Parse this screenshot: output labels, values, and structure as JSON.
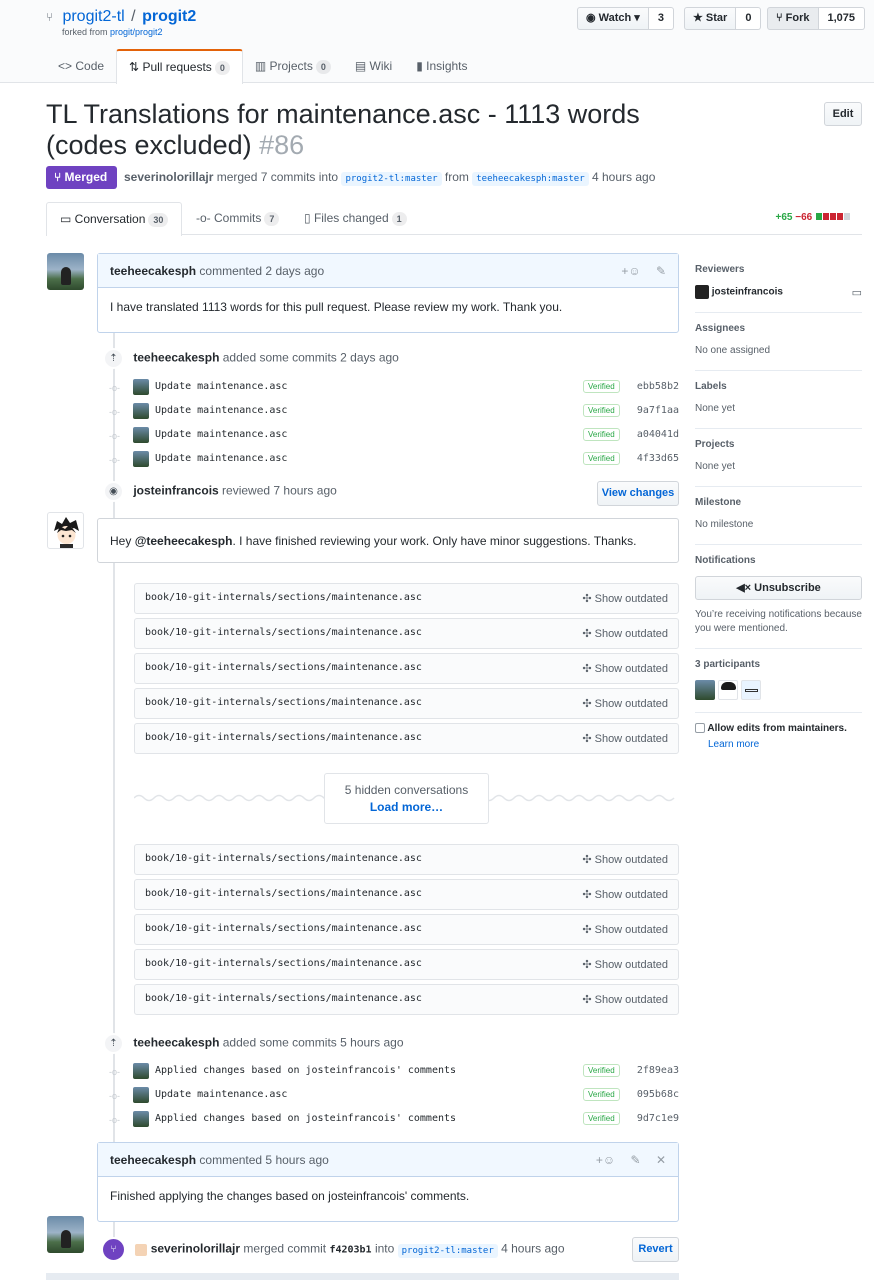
{
  "repo": {
    "owner": "progit2-tl",
    "separator": "/",
    "name": "progit2",
    "forked_prefix": "forked from",
    "forked_from": "progit/progit2",
    "watch_label": "Watch",
    "watch_count": "3",
    "star_label": "Star",
    "star_count": "0",
    "fork_label": "Fork",
    "fork_count": "1,075"
  },
  "nav": {
    "code": "Code",
    "pulls": "Pull requests",
    "pulls_count": "0",
    "projects": "Projects",
    "projects_count": "0",
    "wiki": "Wiki",
    "insights": "Insights"
  },
  "pr": {
    "title": "TL Translations for maintenance.asc - 1113 words (codes excluded)",
    "number": "#86",
    "edit": "Edit",
    "state": "Merged",
    "author": "severinolorillajr",
    "merged_text": "merged 7 commits into",
    "base": "progit2-tl:master",
    "from": "from",
    "head": "teeheecakesph:master",
    "time": "4 hours ago"
  },
  "tabs": {
    "conversation": "Conversation",
    "conversation_count": "30",
    "commits": "Commits",
    "commits_count": "7",
    "files": "Files changed",
    "files_count": "1",
    "additions": "+65",
    "deletions": "−66"
  },
  "comment1": {
    "author": "teeheecakesph",
    "action": "commented 2 days ago",
    "body": "I have translated 1113 words for this pull request. Please review my work. Thank you."
  },
  "event1": {
    "author": "teeheecakesph",
    "action": "added some commits 2 days ago"
  },
  "commits1": [
    {
      "msg": "Update maintenance.asc",
      "verified": "Verified",
      "sha": "ebb58b2"
    },
    {
      "msg": "Update maintenance.asc",
      "verified": "Verified",
      "sha": "9a7f1aa"
    },
    {
      "msg": "Update maintenance.asc",
      "verified": "Verified",
      "sha": "a04041d"
    },
    {
      "msg": "Update maintenance.asc",
      "verified": "Verified",
      "sha": "4f33d65"
    }
  ],
  "review": {
    "author": "josteinfrancois",
    "action": "reviewed 7 hours ago",
    "view_changes": "View changes",
    "body_prefix": "Hey",
    "mention": "@teeheecakesph",
    "body_suffix": ". I have finished reviewing your work. Only have minor suggestions. Thanks."
  },
  "files": {
    "path": "book/10-git-internals/sections/maintenance.asc",
    "show_outdated": "Show outdated"
  },
  "hidden": {
    "text": "5 hidden conversations",
    "load": "Load more…"
  },
  "event2": {
    "author": "teeheecakesph",
    "action": "added some commits 5 hours ago"
  },
  "commits2": [
    {
      "msg": "Applied changes based on josteinfrancois' comments",
      "verified": "Verified",
      "sha": "2f89ea3"
    },
    {
      "msg": "Update maintenance.asc",
      "verified": "Verified",
      "sha": "095b68c"
    },
    {
      "msg": "Applied changes based on josteinfrancois' comments",
      "verified": "Verified",
      "sha": "9d7c1e9"
    }
  ],
  "comment2": {
    "author": "teeheecakesph",
    "action": "commented 5 hours ago",
    "body": "Finished applying the changes based on josteinfrancois' comments."
  },
  "merge_event": {
    "author": "severinolorillajr",
    "text": "merged commit",
    "sha": "f4203b1",
    "into": "into",
    "branch": "progit2-tl:master",
    "time": "4 hours ago",
    "revert": "Revert"
  },
  "sidebar": {
    "reviewers_title": "Reviewers",
    "reviewer": "josteinfrancois",
    "assignees_title": "Assignees",
    "assignees_val": "No one assigned",
    "labels_title": "Labels",
    "labels_val": "None yet",
    "projects_title": "Projects",
    "projects_val": "None yet",
    "milestone_title": "Milestone",
    "milestone_val": "No milestone",
    "notifications_title": "Notifications",
    "unsubscribe": "Unsubscribe",
    "notif_reason": "You’re receiving notifications because you were mentioned.",
    "participants_title": "3 participants",
    "allow_edits": "Allow edits from maintainers.",
    "learn_more": "Learn more"
  }
}
